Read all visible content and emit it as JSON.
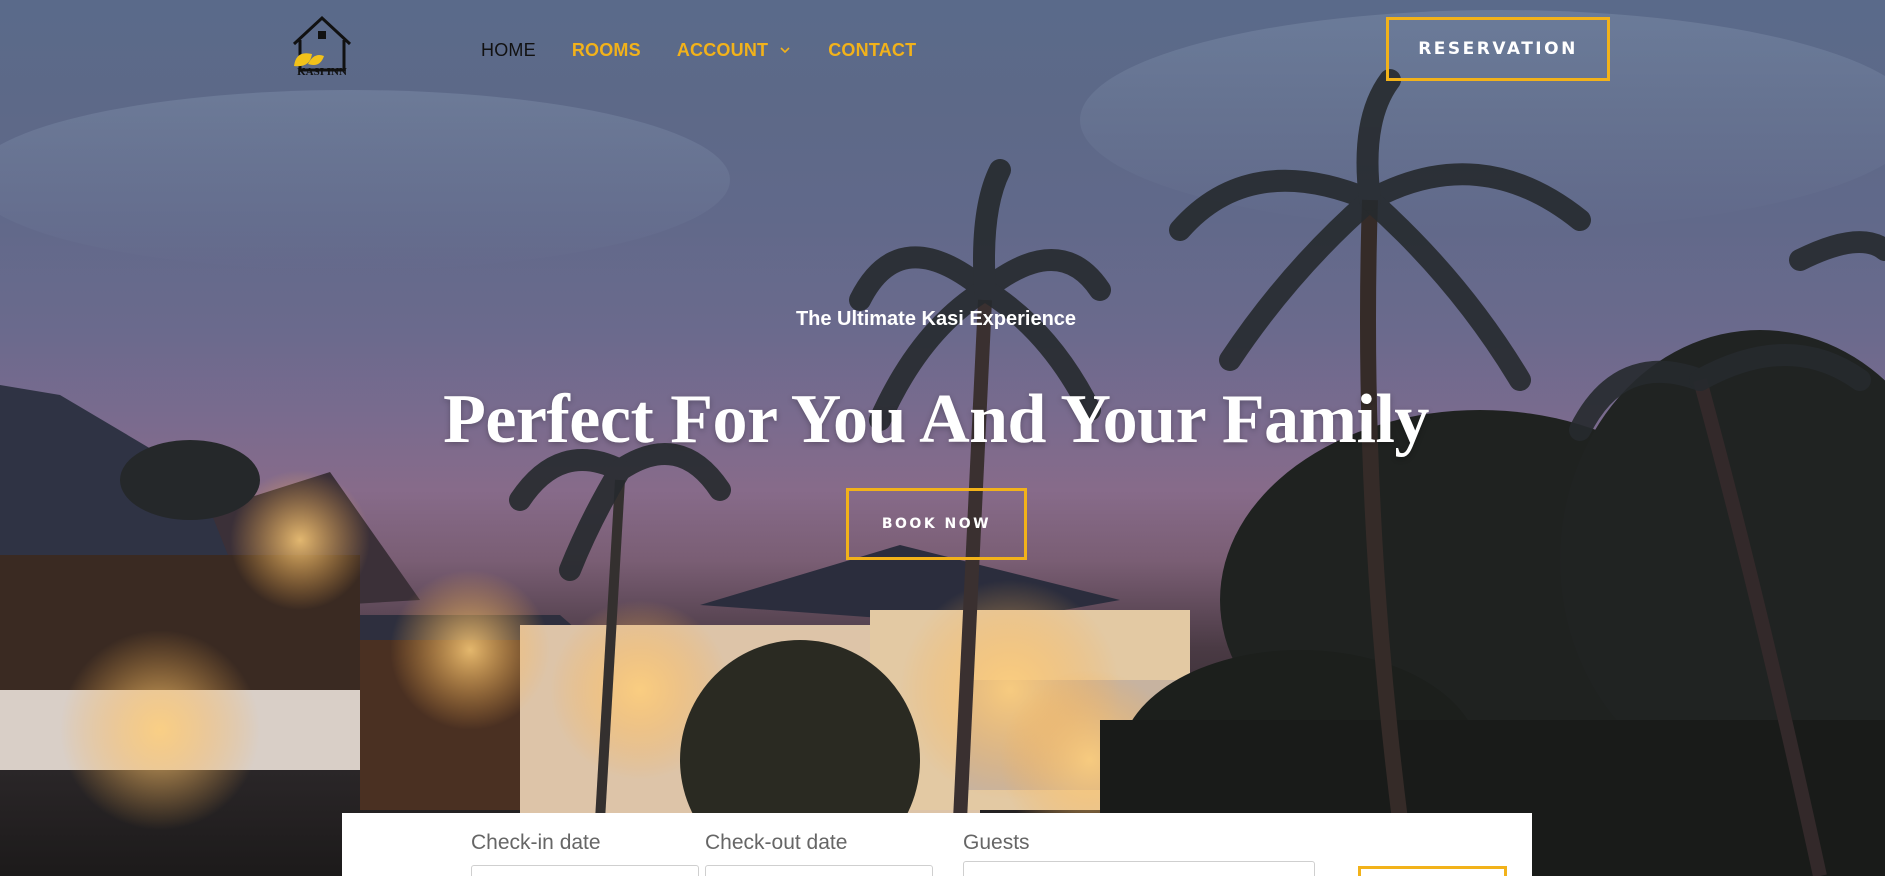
{
  "brand": {
    "logo_text": "KASI INN",
    "accent_color": "#f2b21a",
    "logo_icon": "house-leaf-icon"
  },
  "nav": {
    "items": [
      {
        "label": "HOME",
        "active": true
      },
      {
        "label": "ROOMS",
        "active": false
      },
      {
        "label": "ACCOUNT",
        "active": false,
        "has_dropdown": true
      },
      {
        "label": "CONTACT",
        "active": false
      }
    ],
    "dropdown_icon": "chevron-down-icon"
  },
  "header": {
    "reservation_label": "RESERVATION"
  },
  "hero": {
    "kicker": "The Ultimate Kasi Experience",
    "headline": "Perfect For You And Your Family",
    "cta_label": "BOOK NOW"
  },
  "booking": {
    "checkin_label": "Check-in date",
    "checkout_label": "Check-out date",
    "guests_label": "Guests"
  }
}
